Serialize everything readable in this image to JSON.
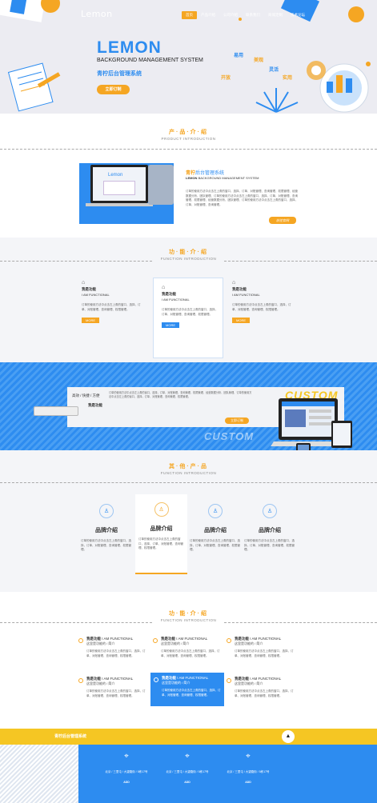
{
  "header": {
    "logo": "Lemon",
    "nav": [
      "首页",
      "产品介绍",
      "公司介绍",
      "联系我们",
      "商城定制",
      "技术论坛"
    ]
  },
  "hero": {
    "title": "LEMON",
    "subtitle": "BACKGROUND MANAGEMENT SYSTEM",
    "cn_title": "青柠后台管理系统",
    "cta": "立即订制",
    "tags": [
      "易用",
      "美观",
      "开放",
      "实用",
      "灵活"
    ]
  },
  "product": {
    "title": "产·品·介·绍",
    "en": "PRODUCT INTRODUCTION",
    "heading_cn": "青柠",
    "heading_cn2": "后台管理系统",
    "heading_en": "LEMON",
    "heading_en2": "BACKGROUND MANAGEMENT SYSTEM",
    "screen_logo": "Lemon",
    "desc": "订单的使用方法中点击左上角的窗口，选择，订单、对账管理、查询管理、权限管理、经营数据分析、团队管理、订单的使用方法中点击左上角的窗口，选择，订单、对账管理、查询管理、权限管理、经营数据分析、团队管理、订单的使用方法中点击左上角的窗口，选择，订单、对账管理、查询管理。",
    "cta": "前往官网"
  },
  "functions": {
    "title": "功·能·介·绍",
    "en": "FUNCTION INTRODUCTION",
    "cards": [
      {
        "cn": "我是功能",
        "en": "I AM FUNCTIONAL",
        "desc": "订单的使用方法中点击左上角的窗口，选择，订单、对账管理、查询管理、权限管理。",
        "more": "MORE"
      },
      {
        "cn": "我是功能",
        "en": "I AM FUNCTIONAL",
        "desc": "订单的使用方法中点击左上角的窗口，选择，订单、对账管理、查询管理、权限管理。",
        "more": "MORE"
      },
      {
        "cn": "我是功能",
        "en": "I AM FUNCTIONAL",
        "desc": "订单的使用方法中点击左上角的窗口，选择，订单、对账管理、查询管理、权限管理。",
        "more": "MORE"
      }
    ]
  },
  "custom": {
    "tagline": "高效 / 快捷 / 方便",
    "func_label": "我是功能",
    "big": "CUSTOM",
    "cta": "立即订制",
    "desc": "订单的使用方法中点击左上角的窗口，选择，订单、对账管理、查询管理、权限管理、经营数据分析、团队管理、订单的使用方法中点击左上角的窗口，选择，订单、对账管理、查询管理、权限管理。"
  },
  "others": {
    "title": "其·他·产·品",
    "en": "FUNCTION INTRODUCTION",
    "cards": [
      {
        "label": "品牌介绍",
        "desc": "订单的使用方法中点击左上角的窗口，选择，订单、对账管理、查询管理、权限管理。"
      },
      {
        "label": "品牌介绍",
        "desc": "订单的使用方法中点击左上角的窗口，选择，订单、对账管理、查询管理、权限管理。"
      },
      {
        "label": "品牌介绍",
        "desc": "订单的使用方法中点击左上角的窗口，选择，订单、对账管理、查询管理、权限管理。"
      },
      {
        "label": "品牌介绍",
        "desc": "订单的使用方法中点击左上角的窗口，选择，订单、对账管理、查询管理、权限管理。"
      }
    ]
  },
  "functions2": {
    "title": "功·能·介·绍",
    "en": "FUNCTION INTRODUCTION",
    "items": [
      {
        "cn": "我是功能",
        "en": "I AM FUNCTIONAL",
        "sub": "这里是功能的 / 简介",
        "desc": "订单的使用方法中点击左上角的窗口，选择，订单、对账管理、查询管理、权限管理。"
      },
      {
        "cn": "我是功能",
        "en": "I AM FUNCTIONAL",
        "sub": "这里是功能的 / 简介",
        "desc": "订单的使用方法中点击左上角的窗口，选择，订单、对账管理、查询管理、权限管理。"
      },
      {
        "cn": "我是功能",
        "en": "I AM FUNCTIONAL",
        "sub": "这里是功能的 / 简介",
        "desc": "订单的使用方法中点击左上角的窗口，选择，订单、对账管理、查询管理、权限管理。"
      },
      {
        "cn": "我是功能",
        "en": "I AM FUNCTIONAL",
        "sub": "这里是功能的 / 简介",
        "desc": "订单的使用方法中点击左上角的窗口，选择，订单、对账管理、查询管理、权限管理。"
      },
      {
        "cn": "我是功能",
        "en": "I AM FUNCTIONAL",
        "sub": "这里是功能的 / 简介",
        "desc": "订单的使用方法中点击左上角的窗口，选择，订单、对账管理、查询管理、权限管理。"
      },
      {
        "cn": "我是功能",
        "en": "I AM FUNCTIONAL",
        "sub": "这里是功能的 / 简介",
        "desc": "订单的使用方法中点击左上角的窗口，选择，订单、对账管理、查询管理、权限管理。"
      }
    ]
  },
  "footer": {
    "title": "青柠后台管理系统",
    "address": "北京 / 三里屯 / 大望路街 / 5栋17号",
    "add": "ADD"
  },
  "colors": {
    "blue": "#2d8cf0",
    "yellow": "#f5a623"
  }
}
